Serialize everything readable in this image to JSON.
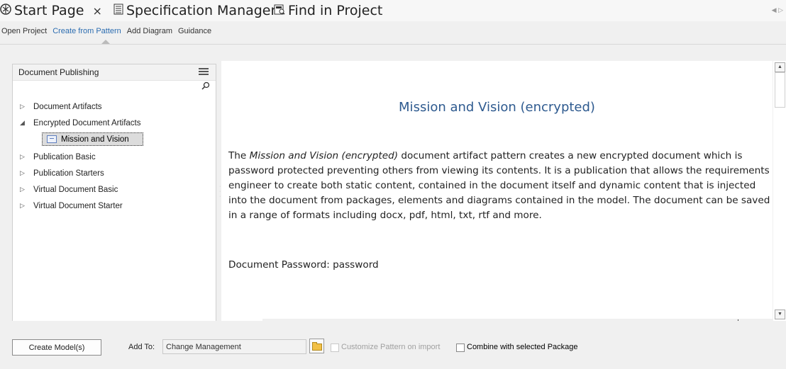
{
  "tabs": [
    {
      "label": "Start Page",
      "icon": "start-page-icon",
      "closable": true,
      "close_glyph": "×"
    },
    {
      "label": "Specification Manager",
      "icon": "specification-icon"
    },
    {
      "label": "Find in Project",
      "icon": "find-icon"
    }
  ],
  "subtabs": [
    "Open Project",
    "Create from Pattern",
    "Add Diagram",
    "Guidance"
  ],
  "active_subtab": "Create from Pattern",
  "panel": {
    "title": "Document Publishing",
    "tree": [
      {
        "label": "Document Artifacts",
        "expanded": false
      },
      {
        "label": "Encrypted Document Artifacts",
        "expanded": true,
        "children": [
          {
            "label": "Mission and Vision",
            "selected": true
          }
        ]
      },
      {
        "label": "Publication Basic",
        "expanded": false
      },
      {
        "label": "Publication Starters",
        "expanded": false
      },
      {
        "label": "Virtual Document Basic",
        "expanded": false
      },
      {
        "label": "Virtual Document Starter",
        "expanded": false
      }
    ]
  },
  "content": {
    "title": "Mission and Vision (encrypted)",
    "para_prefix": "The ",
    "para_italic": "Mission and Vision (encrypted)",
    "para_rest": " document artifact pattern creates a new encrypted document which is password protected preventing others from viewing its contents. It is a publication that allows the requirements engineer to create both static content, contained in the document itself and dynamic content that is injected into the document from packages, elements and diagrams contained in the model. The document can be saved in a range of formats including docx, pdf, html, txt, rtf and more.",
    "password_line": "Document Password: password"
  },
  "bottom": {
    "create_button": "Create Model(s)",
    "add_to_label": "Add To:",
    "add_to_value": "Change Management",
    "customize_label": "Customize Pattern on import",
    "combine_label": "Combine with selected Package"
  },
  "colors": {
    "accent_title": "#2e5a8f",
    "active_subtab": "#2b6cb0",
    "selected_row": "#dcdcdc"
  }
}
